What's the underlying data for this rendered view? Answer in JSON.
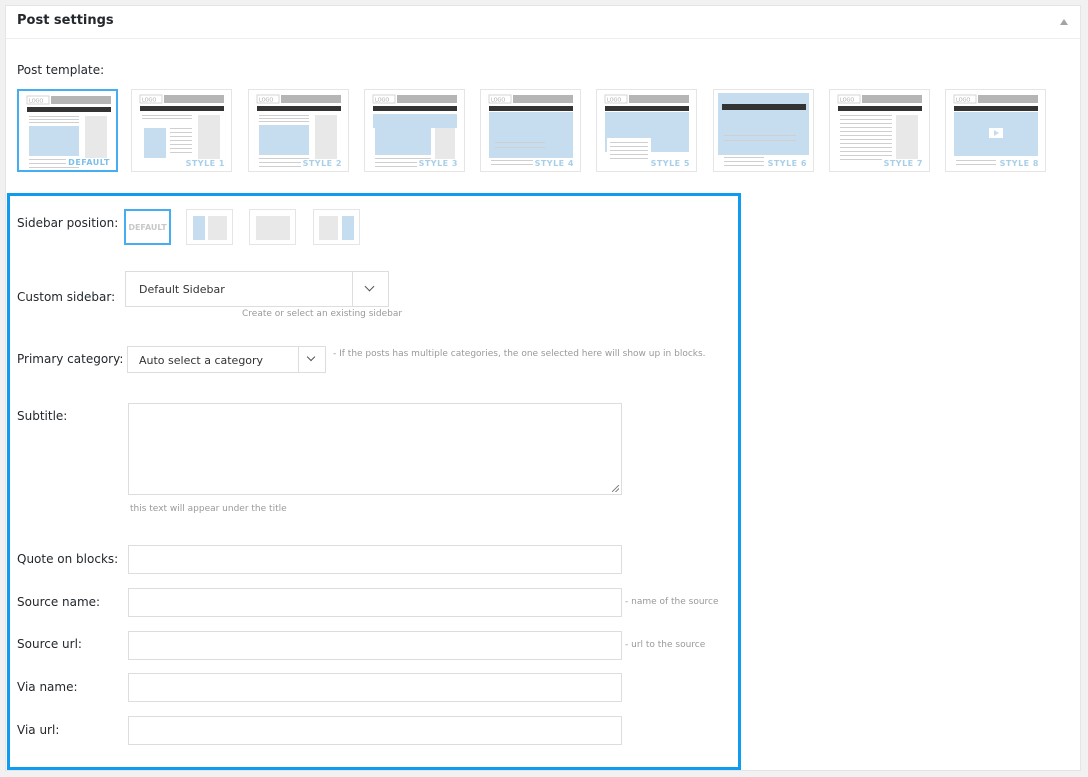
{
  "panel": {
    "title": "Post settings"
  },
  "post_template": {
    "label": "Post template:",
    "logo_text": "LOGO",
    "items": [
      {
        "label": "DEFAULT",
        "selected": true
      },
      {
        "label": "STYLE 1",
        "selected": false
      },
      {
        "label": "STYLE 2",
        "selected": false
      },
      {
        "label": "STYLE 3",
        "selected": false
      },
      {
        "label": "STYLE 4",
        "selected": false
      },
      {
        "label": "STYLE 5",
        "selected": false
      },
      {
        "label": "STYLE 6",
        "selected": false
      },
      {
        "label": "STYLE 7",
        "selected": false
      },
      {
        "label": "STYLE 8",
        "selected": false
      }
    ]
  },
  "sidebar_position": {
    "label": "Sidebar position:",
    "options": [
      {
        "label": "DEFAULT",
        "kind": "default",
        "selected": true
      },
      {
        "label": "",
        "kind": "left",
        "selected": false
      },
      {
        "label": "",
        "kind": "none",
        "selected": false
      },
      {
        "label": "",
        "kind": "right",
        "selected": false
      }
    ]
  },
  "custom_sidebar": {
    "label": "Custom sidebar:",
    "value": "Default Sidebar",
    "hint": "Create or select an existing sidebar"
  },
  "primary_category": {
    "label": "Primary category:",
    "value": "Auto select a category",
    "hint": "- If the posts has multiple categories, the one selected here will show up in blocks."
  },
  "subtitle": {
    "label": "Subtitle:",
    "value": "",
    "hint": "this text will appear under the title"
  },
  "quote_on_blocks": {
    "label": "Quote on blocks:",
    "value": ""
  },
  "source_name": {
    "label": "Source name:",
    "value": "",
    "hint": "- name of the source"
  },
  "source_url": {
    "label": "Source url:",
    "value": "",
    "hint": "- url to the source"
  },
  "via_name": {
    "label": "Via name:",
    "value": ""
  },
  "via_url": {
    "label": "Via url:",
    "value": ""
  },
  "colors": {
    "accent": "#0e9bf0",
    "thumb_blue": "#c5ddef",
    "thumb_dark": "#333333",
    "thumb_gray": "#e8e8e8",
    "thumb_header": "#b5b5b5"
  }
}
